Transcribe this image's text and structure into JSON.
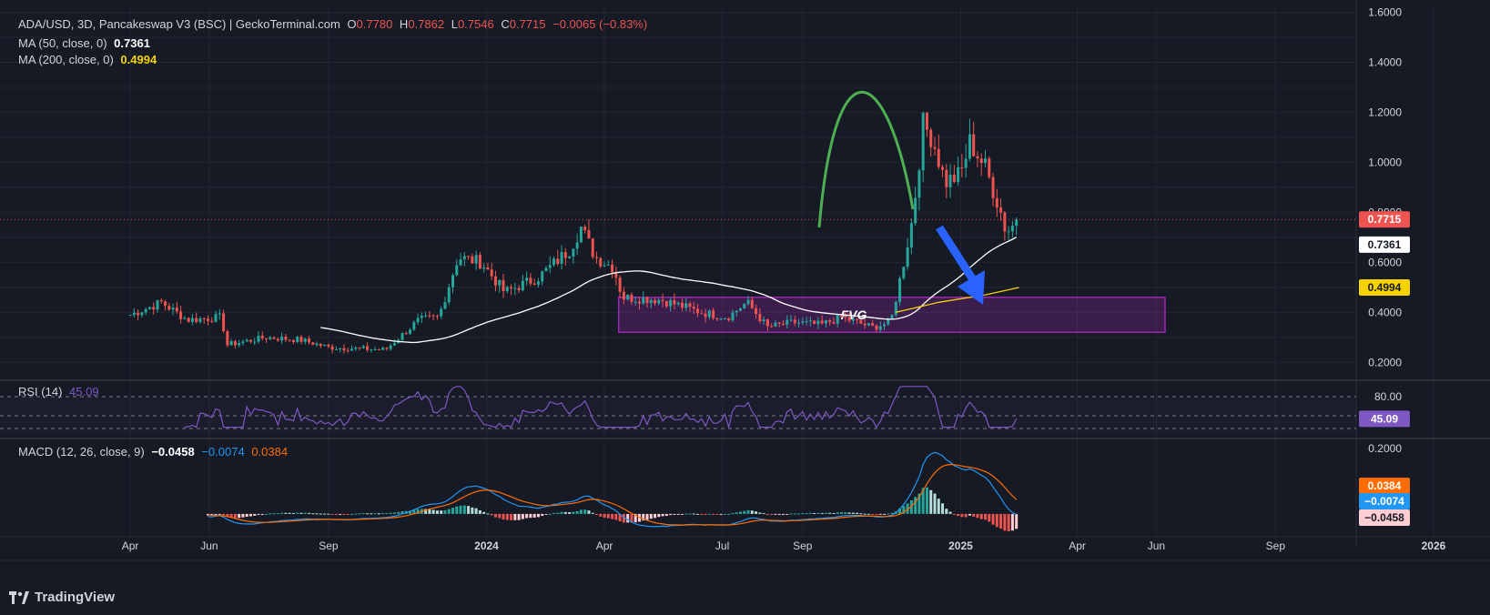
{
  "header": {
    "symbol": "ADA/USD, 3D, Pancakeswap V3 (BSC) | GeckoTerminal.com",
    "o_label": "O",
    "o_value": "0.7780",
    "h_label": "H",
    "h_value": "0.7862",
    "l_label": "L",
    "l_value": "0.7546",
    "c_label": "C",
    "c_value": "0.7715",
    "change": "−0.0065 (−0.83%)"
  },
  "ma50": {
    "label": "MA (50, close, 0)",
    "value": "0.7361"
  },
  "ma200": {
    "label": "MA (200, close, 0)",
    "value": "0.4994"
  },
  "rsi": {
    "label": "RSI (14)",
    "value": "45.09",
    "axis": [
      "80.00"
    ],
    "badge": "45.09"
  },
  "macd": {
    "label": "MACD (12, 26, close, 9)",
    "v1": "−0.0458",
    "v2": "−0.0074",
    "v3": "0.0384",
    "axis": [
      "0.2000"
    ],
    "badges": [
      "0.0384",
      "−0.0074",
      "−0.0458"
    ]
  },
  "price_axis": [
    "1.6000",
    "1.4000",
    "1.2000",
    "1.0000",
    "0.8000",
    "0.6000",
    "0.4000",
    "0.2000"
  ],
  "price_badges": {
    "close": "0.7715",
    "ma50": "0.7361",
    "ma200": "0.4994"
  },
  "annotation": {
    "fvg": "FVG"
  },
  "colors": {
    "up": "#26a69a",
    "down": "#ef5350",
    "ma50": "#ffffff",
    "ma200": "#f5d300",
    "rsi": "#7e57c2",
    "macd": "#2196f3",
    "signal": "#ff6d00",
    "fvg": "#9c27b0",
    "arrow": "#2962ff",
    "arc": "#4caf50"
  },
  "footer": {
    "brand": "TradingView"
  },
  "chart_data": {
    "type": "line",
    "x_ticks": [
      "Apr",
      "Jun",
      "Sep",
      "2024",
      "Apr",
      "Jul",
      "Sep",
      "2025",
      "Apr",
      "Jun",
      "Sep",
      "2026"
    ],
    "ylim": [
      0.15,
      1.62
    ],
    "last_close": 0.7715,
    "close_anchors": [
      [
        "2023-04-01",
        0.39
      ],
      [
        "2023-04-25",
        0.44
      ],
      [
        "2023-05-15",
        0.37
      ],
      [
        "2023-06-10",
        0.38
      ],
      [
        "2023-06-15",
        0.27
      ],
      [
        "2023-07-15",
        0.3
      ],
      [
        "2023-08-10",
        0.29
      ],
      [
        "2023-09-01",
        0.26
      ],
      [
        "2023-10-15",
        0.25
      ],
      [
        "2023-11-10",
        0.37
      ],
      [
        "2023-11-25",
        0.38
      ],
      [
        "2023-12-10",
        0.62
      ],
      [
        "2023-12-28",
        0.6
      ],
      [
        "2024-01-15",
        0.48
      ],
      [
        "2024-02-10",
        0.54
      ],
      [
        "2024-03-05",
        0.65
      ],
      [
        "2024-03-14",
        0.74
      ],
      [
        "2024-03-25",
        0.62
      ],
      [
        "2024-04-08",
        0.58
      ],
      [
        "2024-04-15",
        0.46
      ],
      [
        "2024-05-15",
        0.45
      ],
      [
        "2024-06-15",
        0.4
      ],
      [
        "2024-07-05",
        0.38
      ],
      [
        "2024-07-20",
        0.44
      ],
      [
        "2024-08-05",
        0.34
      ],
      [
        "2024-08-25",
        0.36
      ],
      [
        "2024-09-15",
        0.35
      ],
      [
        "2024-10-01",
        0.38
      ],
      [
        "2024-10-25",
        0.34
      ],
      [
        "2024-11-08",
        0.36
      ],
      [
        "2024-11-18",
        0.6
      ],
      [
        "2024-11-25",
        0.78
      ],
      [
        "2024-12-03",
        1.15
      ],
      [
        "2024-12-10",
        1.1
      ],
      [
        "2024-12-20",
        0.92
      ],
      [
        "2025-01-01",
        0.95
      ],
      [
        "2025-01-08",
        1.08
      ],
      [
        "2025-01-20",
        0.98
      ],
      [
        "2025-02-01",
        0.8
      ],
      [
        "2025-02-05",
        0.72
      ],
      [
        "2025-02-15",
        0.7715
      ]
    ],
    "fvg_zone": {
      "label": "FVG",
      "y_low": 0.32,
      "y_high": 0.46
    },
    "rsi": {
      "ylim": [
        20,
        100
      ],
      "level": 80,
      "last": 45.09
    },
    "macd": {
      "ylim": [
        -0.07,
        0.22
      ],
      "last_macd": -0.0074,
      "last_signal": 0.0384,
      "last_hist": -0.0458
    }
  }
}
